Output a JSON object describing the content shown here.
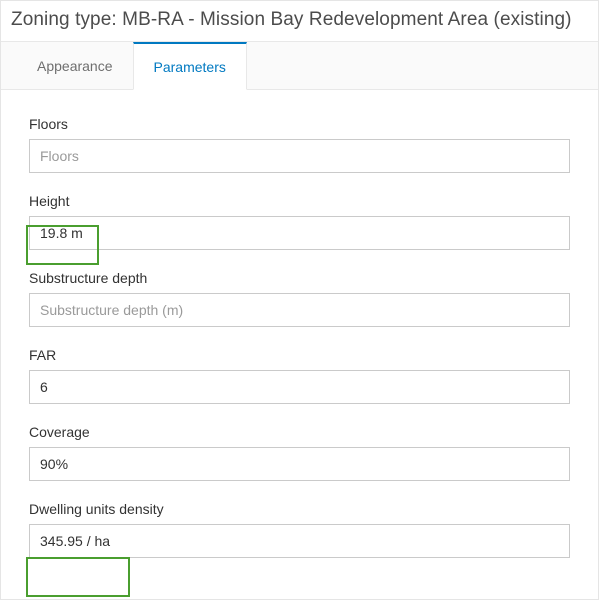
{
  "header": {
    "title": "Zoning type: MB-RA - Mission Bay Redevelopment Area (existing)"
  },
  "tabs": [
    {
      "id": "appearance",
      "label": "Appearance",
      "active": false
    },
    {
      "id": "parameters",
      "label": "Parameters",
      "active": true
    }
  ],
  "fields": {
    "floors": {
      "label": "Floors",
      "value": "",
      "placeholder": "Floors"
    },
    "height": {
      "label": "Height",
      "value": "19.8 m",
      "placeholder": ""
    },
    "subdepth": {
      "label": "Substructure depth",
      "value": "",
      "placeholder": "Substructure depth (m)"
    },
    "far": {
      "label": "FAR",
      "value": "6",
      "placeholder": ""
    },
    "coverage": {
      "label": "Coverage",
      "value": "90%",
      "placeholder": ""
    },
    "density": {
      "label": "Dwelling units density",
      "value": "345.95 / ha",
      "placeholder": ""
    }
  }
}
